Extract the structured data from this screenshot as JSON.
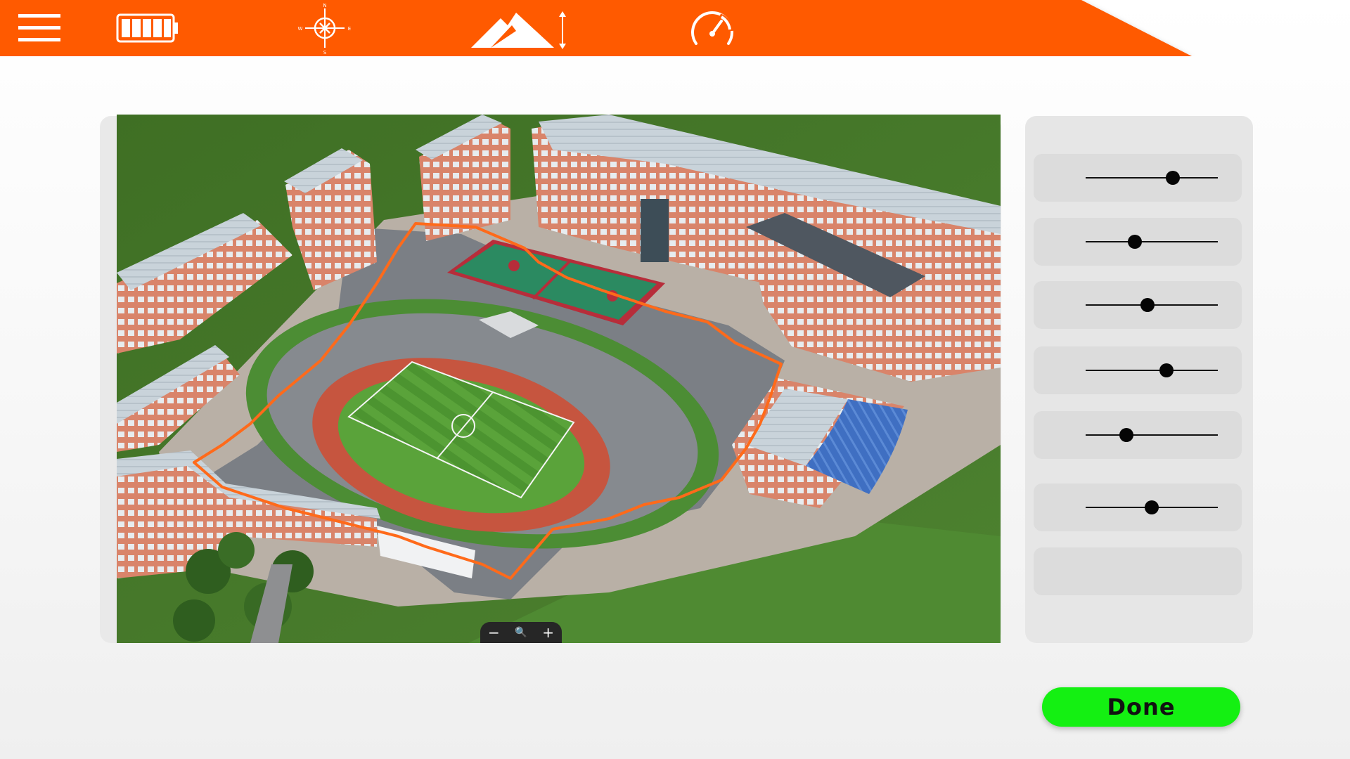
{
  "topbar": {
    "accent_color": "#ff5a00",
    "icons": [
      "menu-icon",
      "battery-icon",
      "compass-icon",
      "altitude-icon",
      "speedometer-icon"
    ],
    "compass_letters": {
      "n": "N",
      "s": "S",
      "e": "E",
      "w": "W"
    }
  },
  "map": {
    "image": "aerial-view-of-school-campus-with-running-track",
    "route_color": "#ff6a1a",
    "zoom_controls": {
      "zoom_out": "−",
      "zoom_search": "🔍",
      "zoom_in": "+"
    }
  },
  "sliders": [
    {
      "name": "slider-1",
      "value": 0.66
    },
    {
      "name": "slider-2",
      "value": 0.37
    },
    {
      "name": "slider-3",
      "value": 0.47
    },
    {
      "name": "slider-4",
      "value": 0.61
    },
    {
      "name": "slider-5",
      "value": 0.31
    },
    {
      "name": "slider-6",
      "value": 0.5
    },
    {
      "name": "slider-7",
      "value": null
    }
  ],
  "done_button": {
    "label": "Done",
    "color": "#14f012"
  }
}
